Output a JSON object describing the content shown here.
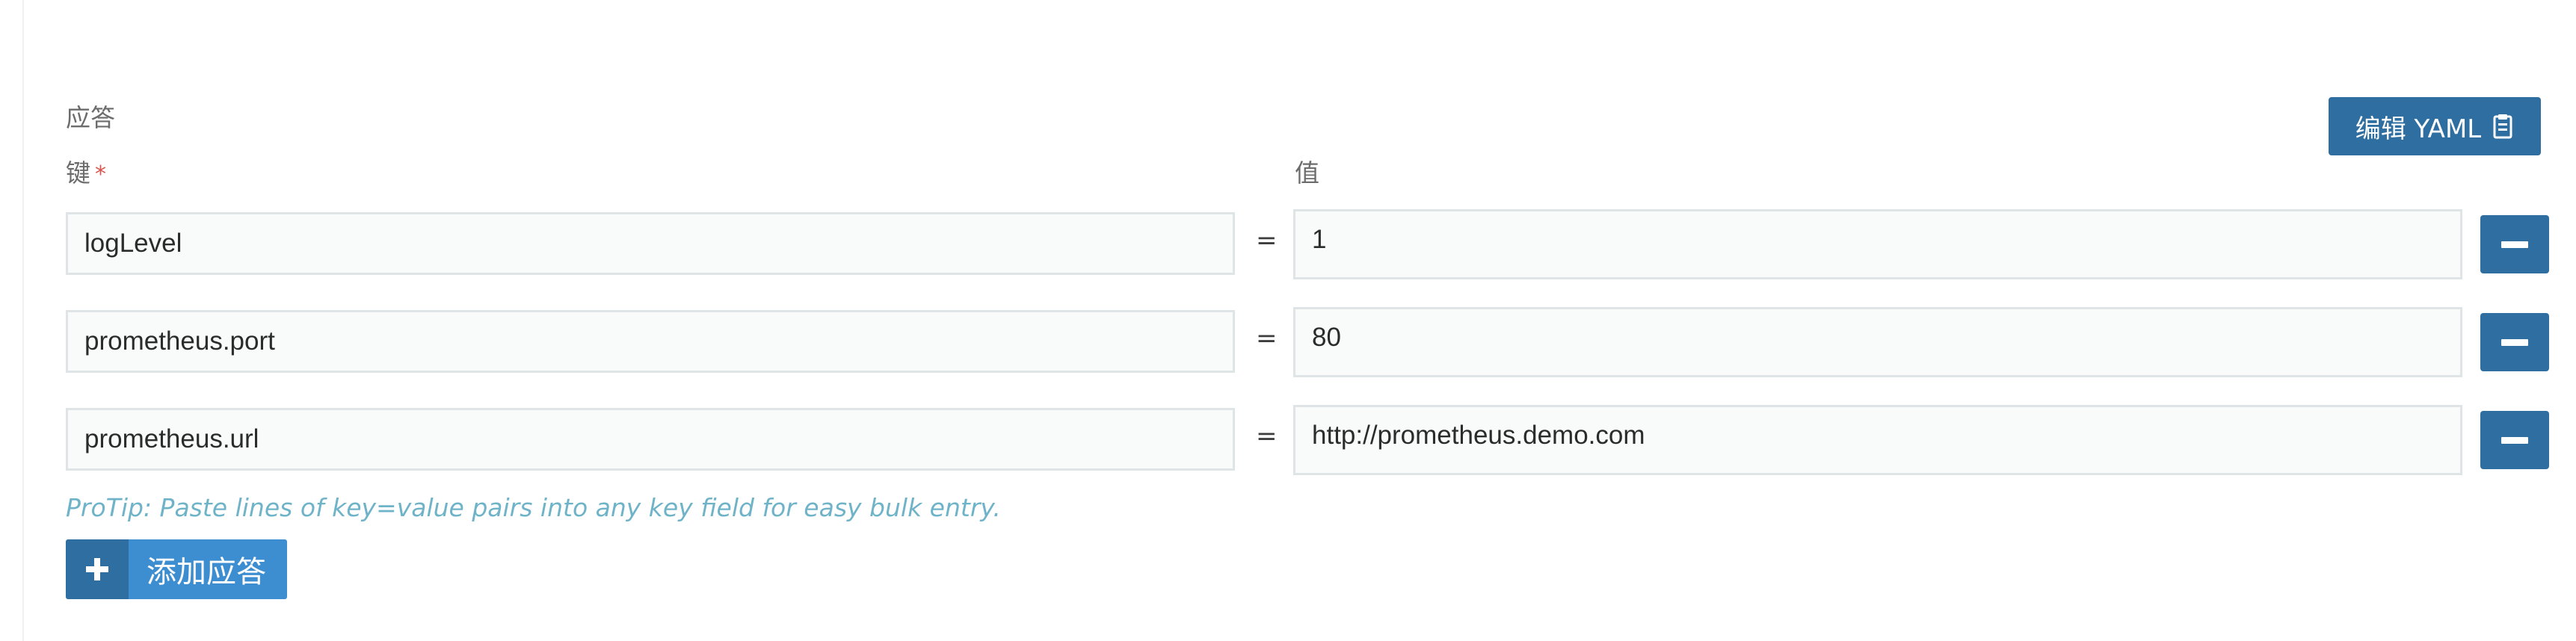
{
  "answers": {
    "section_title": "应答",
    "edit_yaml_label": "编辑 YAML",
    "key_header": "键",
    "required_mark": "*",
    "value_header": "值",
    "equals": "=",
    "rows": [
      {
        "key": "logLevel",
        "value": "1"
      },
      {
        "key": "prometheus.port",
        "value": "80"
      },
      {
        "key": "prometheus.url",
        "value": "http://prometheus.demo.com"
      }
    ],
    "protip": "ProTip: Paste lines of key=value pairs into any key field for easy bulk entry.",
    "add_label": "添加应答"
  },
  "icons": {
    "yaml_button": "clipboard-icon",
    "remove_button": "minus-icon",
    "add_button": "plus-icon"
  },
  "colors": {
    "primary_button": "#2f6ea0",
    "add_label_bg": "#3d8ed0",
    "protip_text": "#6fb3c9",
    "required_star": "#d9534f",
    "field_border": "#dfe4e6",
    "field_bg": "#f9fafa"
  }
}
